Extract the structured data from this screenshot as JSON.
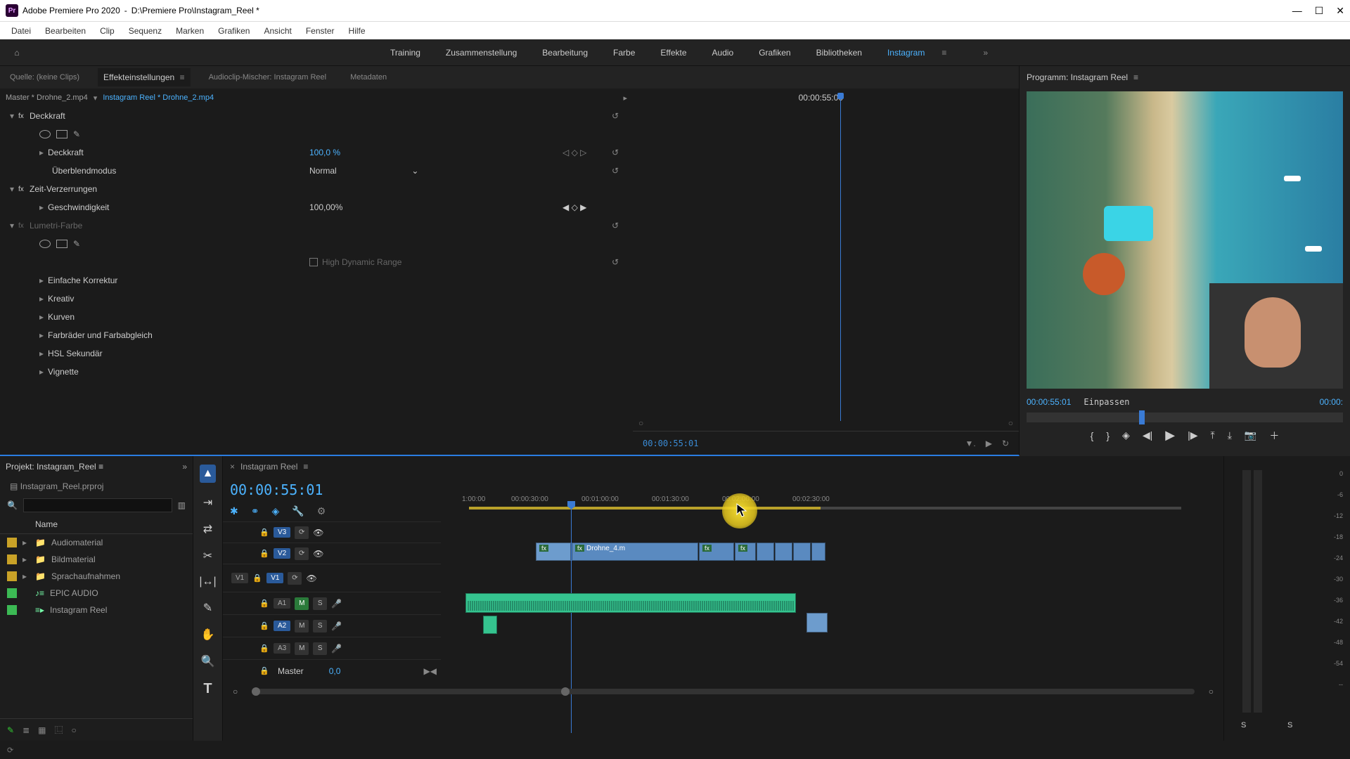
{
  "titlebar": {
    "app": "Adobe Premiere Pro 2020",
    "project_path": "D:\\Premiere Pro\\Instagram_Reel *"
  },
  "menu": [
    "Datei",
    "Bearbeiten",
    "Clip",
    "Sequenz",
    "Marken",
    "Grafiken",
    "Ansicht",
    "Fenster",
    "Hilfe"
  ],
  "workspaces": {
    "items": [
      "Training",
      "Zusammenstellung",
      "Bearbeitung",
      "Farbe",
      "Effekte",
      "Audio",
      "Grafiken",
      "Bibliotheken",
      "Instagram"
    ],
    "active": "Instagram"
  },
  "source_tabs": {
    "source": "Quelle: (keine Clips)",
    "effect_controls": "Effekteinstellungen",
    "audio_mixer": "Audioclip-Mischer: Instagram Reel",
    "metadata": "Metadaten"
  },
  "effect_controls": {
    "crumb_master": "Master * Drohne_2.mp4",
    "crumb_seq": "Instagram Reel * Drohne_2.mp4",
    "timeline_tc": "00:00:55:00",
    "foot_tc": "00:00:55:01",
    "sections": {
      "opacity": {
        "title": "Deckkraft",
        "value_label": "Deckkraft",
        "value": "100,0 %",
        "blend_label": "Überblendmodus",
        "blend_value": "Normal"
      },
      "time": {
        "title": "Zeit-Verzerrungen",
        "speed_label": "Geschwindigkeit",
        "speed_value": "100,00%"
      },
      "lumetri": {
        "title": "Lumetri-Farbe",
        "hdr": "High Dynamic Range",
        "groups": [
          "Einfache Korrektur",
          "Kreativ",
          "Kurven",
          "Farbräder und Farbabgleich",
          "HSL Sekundär",
          "Vignette"
        ]
      }
    }
  },
  "program": {
    "title": "Programm: Instagram Reel",
    "tc": "00:00:55:01",
    "fit": "Einpassen",
    "total": "00:00:"
  },
  "project": {
    "title": "Projekt: Instagram_Reel",
    "filename": "Instagram_Reel.prproj",
    "search_placeholder": "",
    "col_name": "Name",
    "bins": [
      {
        "label": "Audiomaterial",
        "color": "#c9a227",
        "type": "bin"
      },
      {
        "label": "Bildmaterial",
        "color": "#c9a227",
        "type": "bin"
      },
      {
        "label": "Sprachaufnahmen",
        "color": "#c9a227",
        "type": "bin"
      },
      {
        "label": "EPIC AUDIO",
        "color": "#3cba54",
        "type": "item"
      },
      {
        "label": "Instagram Reel",
        "color": "#3cba54",
        "type": "seq"
      }
    ]
  },
  "timeline": {
    "title": "Instagram Reel",
    "tc": "00:00:55:01",
    "ruler": [
      "1:00:00",
      "00:00:30:00",
      "00:01:00:00",
      "00:01:30:00",
      "00:02:00:00",
      "00:02:30:00"
    ],
    "vtracks": [
      {
        "id": "V3",
        "enabled": true
      },
      {
        "id": "V2",
        "enabled": true
      },
      {
        "id": "V1",
        "enabled": true,
        "patched": true
      }
    ],
    "atracks": [
      {
        "id": "A1",
        "m": true
      },
      {
        "id": "A2",
        "m": false
      },
      {
        "id": "A3",
        "m": false
      }
    ],
    "master": {
      "label": "Master",
      "value": "0,0"
    },
    "clips": {
      "v2": {
        "label": "Drohne_4.m"
      }
    }
  },
  "meters": {
    "scale": [
      "0",
      "-6",
      "-12",
      "-18",
      "-24",
      "-30",
      "-36",
      "-42",
      "-48",
      "-54",
      "--"
    ],
    "s": "S"
  },
  "icons": {
    "home": "⌂",
    "burger": "≡",
    "chev_r": "▸",
    "chev_d": "▾",
    "reset": "↺",
    "keyf_prev": "◁",
    "keyf": "◇",
    "keyf_next": "▷",
    "search": "🔍",
    "folder": "📁",
    "eye": "👁",
    "lock": "🔒",
    "mic": "🎤",
    "pen": "✎",
    "wrench": "🔧",
    "marker": "◈",
    "plus": "＋",
    "snap": "⎊",
    "link": "⚭",
    "chevrons": "»"
  }
}
